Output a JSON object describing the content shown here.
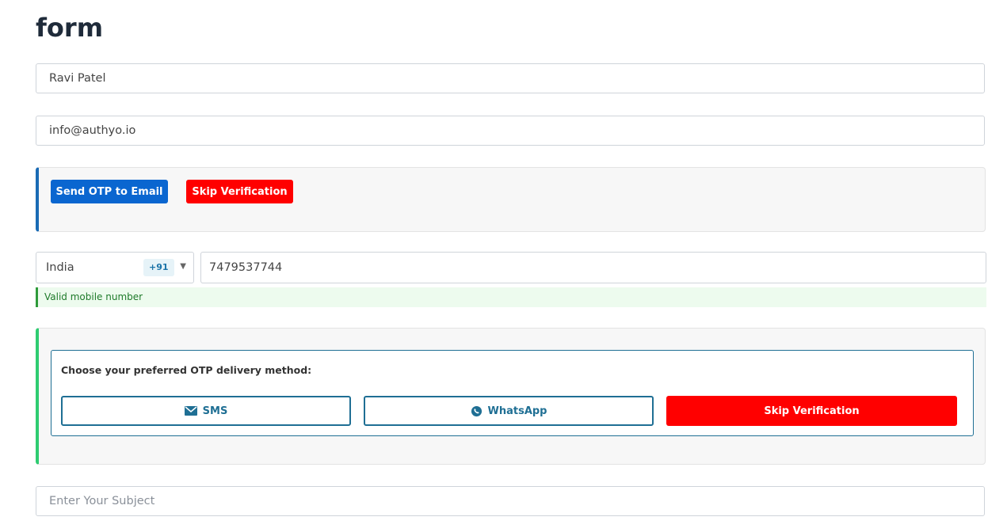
{
  "page": {
    "title": "form"
  },
  "name_field": {
    "value": "Ravi Patel"
  },
  "email_field": {
    "value": "info@authyo.io"
  },
  "email_verification": {
    "send_label": "Send OTP to Email",
    "skip_label": "Skip Verification"
  },
  "phone": {
    "country": "India",
    "dial_code": "+91",
    "number": "7479537744",
    "validation_message": "Valid mobile number"
  },
  "otp_method": {
    "prompt": "Choose your preferred OTP delivery method:",
    "sms_label": "SMS",
    "whatsapp_label": "WhatsApp",
    "skip_label": "Skip Verification"
  },
  "subject_field": {
    "placeholder": "Enter Your Subject",
    "value": ""
  },
  "icons": {
    "sms": "envelope-icon",
    "whatsapp": "whatsapp-icon",
    "dropdown": "caret-down-icon"
  },
  "colors": {
    "primary": "#0a66d0",
    "danger": "#ff0000",
    "accent": "#1f6f94",
    "success": "#2ecc71"
  }
}
